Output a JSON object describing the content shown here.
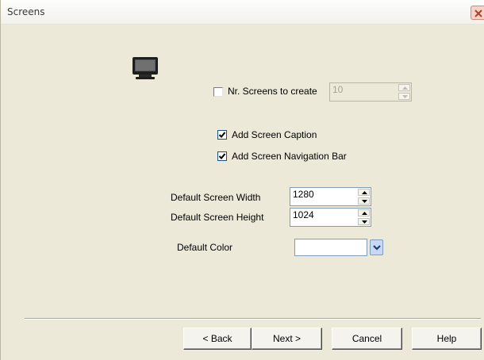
{
  "window": {
    "title": "Screens"
  },
  "icons": {
    "monitor": "monitor-icon",
    "close": "close-icon"
  },
  "options": {
    "nr_screens": {
      "label": "Nr. Screens to create",
      "checked": false,
      "value": "10",
      "enabled": false
    },
    "add_caption": {
      "label": "Add Screen Caption",
      "checked": true
    },
    "add_nav_bar": {
      "label": "Add Screen Navigation Bar",
      "checked": true
    }
  },
  "defaults": {
    "width_label": "Default Screen Width",
    "width_value": "1280",
    "height_label": "Default Screen Height",
    "height_value": "1024",
    "color_label": "Default Color",
    "color_value": "#ffffff"
  },
  "buttons": {
    "back": "< Back",
    "next": "Next >",
    "cancel": "Cancel",
    "help": "Help"
  },
  "colors": {
    "dialog_bg": "#ece9d8",
    "checkbox_border": "#1c5180",
    "input_border": "#7f9db9"
  }
}
